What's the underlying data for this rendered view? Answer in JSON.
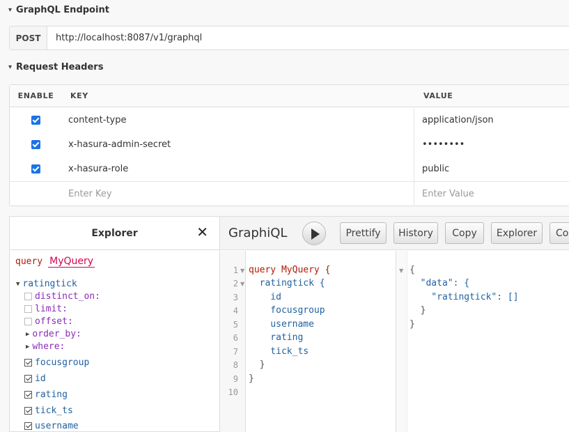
{
  "endpoint": {
    "section_title": "GraphQL Endpoint",
    "method": "POST",
    "url": "http://localhost:8087/v1/graphql"
  },
  "headers": {
    "section_title": "Request Headers",
    "columns": {
      "enable": "ENABLE",
      "key": "KEY",
      "value": "VALUE"
    },
    "rows": [
      {
        "key": "content-type",
        "value": "application/json",
        "enabled": true
      },
      {
        "key": "x-hasura-admin-secret",
        "value": "••••••••",
        "enabled": true
      },
      {
        "key": "x-hasura-role",
        "value": "public",
        "enabled": true
      }
    ],
    "key_placeholder": "Enter Key",
    "value_placeholder": "Enter Value"
  },
  "explorer": {
    "title": "Explorer",
    "close": "✕",
    "query_keyword": "query",
    "operation_name": "MyQuery",
    "root_field": "ratingtick",
    "args": [
      "distinct_on:",
      "limit:",
      "offset:",
      "order_by:",
      "where:"
    ],
    "fields": [
      "focusgroup",
      "id",
      "rating",
      "tick_ts",
      "username"
    ]
  },
  "graphiql": {
    "title": "GraphiQL",
    "buttons": {
      "prettify": "Prettify",
      "history": "History",
      "copy": "Copy",
      "explorer": "Explorer",
      "code": "Code"
    }
  },
  "editor": {
    "line_numbers": [
      "1",
      "2",
      "3",
      "4",
      "5",
      "6",
      "7",
      "8",
      "9",
      "10"
    ],
    "lines": [
      "query MyQuery {",
      "  ratingtick {",
      "    id",
      "    focusgroup",
      "    username",
      "    rating",
      "    tick_ts",
      "  }",
      "}",
      ""
    ]
  },
  "result": {
    "lines": [
      "{",
      "  \"data\": {",
      "    \"ratingtick\": []",
      "  }",
      "}"
    ]
  }
}
